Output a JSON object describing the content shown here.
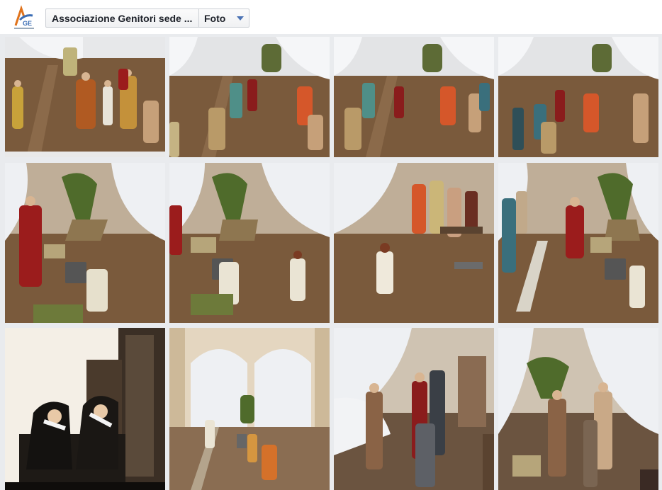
{
  "header": {
    "page_name": "Associazione Genitori sede ...",
    "section": "Foto",
    "logo_icon": "agesc-logo-icon"
  },
  "colors": {
    "floor": "#7a5a3c",
    "curtain": "#eef0f3",
    "red_costume": "#9b1c1c",
    "gold_costume": "#c69a3a",
    "green_plant": "#4f6b2b",
    "dark_interior": "#2a2420"
  },
  "photos": [
    {
      "icon": "theatre-stage-photo"
    },
    {
      "icon": "theatre-stage-photo"
    },
    {
      "icon": "theatre-stage-photo"
    },
    {
      "icon": "theatre-stage-photo"
    },
    {
      "icon": "theatre-stage-photo"
    },
    {
      "icon": "theatre-stage-photo"
    },
    {
      "icon": "theatre-stage-photo"
    },
    {
      "icon": "theatre-stage-photo"
    },
    {
      "icon": "window-nuns-photo"
    },
    {
      "icon": "courtyard-arches-photo"
    },
    {
      "icon": "theatre-stage-photo"
    },
    {
      "icon": "theatre-stage-photo"
    }
  ]
}
